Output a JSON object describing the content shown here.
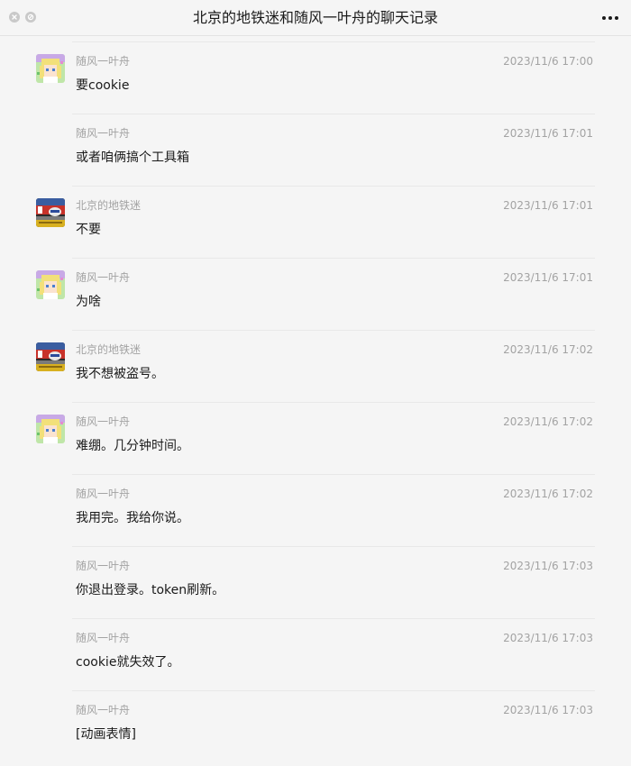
{
  "window": {
    "title": "北京的地铁迷和随风一叶舟的聊天记录"
  },
  "messages": [
    {
      "sender": "随风一叶舟",
      "time": "2023/11/6 17:00",
      "content": "要cookie",
      "avatar": "anime"
    },
    {
      "sender": "随风一叶舟",
      "time": "2023/11/6 17:01",
      "content": "或者咱俩搞个工具箱",
      "avatar": ""
    },
    {
      "sender": "北京的地铁迷",
      "time": "2023/11/6 17:01",
      "content": "不要",
      "avatar": "metro"
    },
    {
      "sender": "随风一叶舟",
      "time": "2023/11/6 17:01",
      "content": "为啥",
      "avatar": "anime"
    },
    {
      "sender": "北京的地铁迷",
      "time": "2023/11/6 17:02",
      "content": "我不想被盗号。",
      "avatar": "metro"
    },
    {
      "sender": "随风一叶舟",
      "time": "2023/11/6 17:02",
      "content": "难绷。几分钟时间。",
      "avatar": "anime"
    },
    {
      "sender": "随风一叶舟",
      "time": "2023/11/6 17:02",
      "content": "我用完。我给你说。",
      "avatar": ""
    },
    {
      "sender": "随风一叶舟",
      "time": "2023/11/6 17:03",
      "content": "你退出登录。token刷新。",
      "avatar": ""
    },
    {
      "sender": "随风一叶舟",
      "time": "2023/11/6 17:03",
      "content": "cookie就失效了。",
      "avatar": ""
    },
    {
      "sender": "随风一叶舟",
      "time": "2023/11/6 17:03",
      "content": "[动画表情]",
      "avatar": ""
    }
  ]
}
